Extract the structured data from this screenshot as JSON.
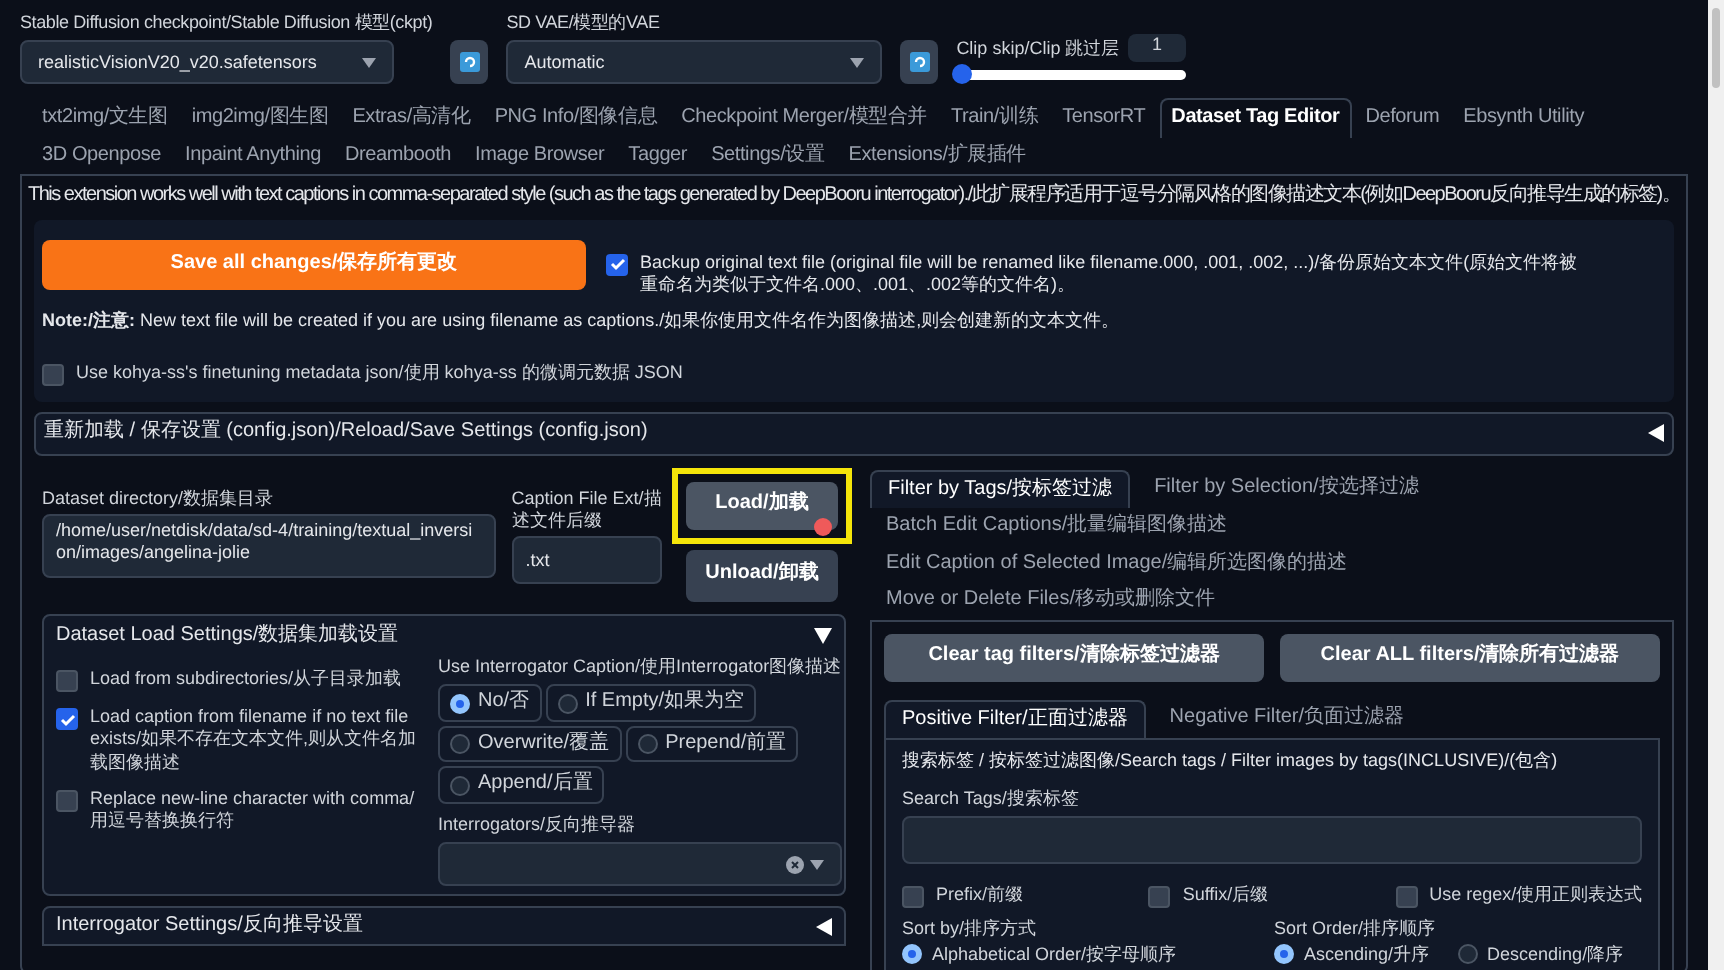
{
  "top": {
    "checkpoint": {
      "label": "Stable Diffusion checkpoint/Stable Diffusion 模型(ckpt)",
      "value": "realisticVisionV20_v20.safetensors"
    },
    "vae": {
      "label": "SD VAE/模型的VAE",
      "value": "Automatic"
    },
    "clip_skip": {
      "label": "Clip skip/Clip 跳过层",
      "value": "1",
      "level": 0.0
    }
  },
  "tabs": [
    [
      {
        "label": "txt2img/文生图",
        "selected": false
      },
      {
        "label": "img2img/图生图",
        "selected": false
      },
      {
        "label": "Extras/高清化",
        "selected": false
      },
      {
        "label": "PNG Info/图像信息",
        "selected": false
      },
      {
        "label": "Checkpoint Merger/模型合并",
        "selected": false
      },
      {
        "label": "Train/训练",
        "selected": false
      },
      {
        "label": "TensorRT",
        "selected": false
      },
      {
        "label": "Dataset Tag Editor",
        "selected": true
      },
      {
        "label": "Deforum",
        "selected": false
      },
      {
        "label": "Ebsynth Utility",
        "selected": false
      }
    ],
    [
      {
        "label": "3D Openpose",
        "selected": false
      },
      {
        "label": "Inpaint Anything",
        "selected": false
      },
      {
        "label": "Dreambooth",
        "selected": false
      },
      {
        "label": "Image Browser",
        "selected": false
      },
      {
        "label": "Tagger",
        "selected": false
      },
      {
        "label": "Settings/设置",
        "selected": false
      },
      {
        "label": "Extensions/扩展插件",
        "selected": false
      }
    ]
  ],
  "info": "This extension works well with text captions in comma-separated style (such as the tags generated by DeepBooru interrogator)./此扩展程序适用于逗号分隔风格的图像描述文本(例如DeepBooru反向推导生成的标签)。",
  "save_button": "Save all changes/保存所有更改",
  "backup": {
    "label": "Backup original text file (original file will be renamed like filename.000, .001, .002, ...)/备份原始文本文件(原始文件将被重命名为类似于文件名.000、.001、.002等的文件名)。",
    "checked": true
  },
  "note": "**Note:/注意:** New text file will be created if you are using filename as captions./如果你使用文件名作为图像描述,则会创建新的文本文件。",
  "kohya": {
    "label": "Use kohya-ss's finetuning metadata json/使用 kohya-ss 的微调元数据 JSON",
    "checked": false
  },
  "reload_section": {
    "title": "重新加载 / 保存设置 (config.json)/Reload/Save Settings (config.json)",
    "expanded": false
  },
  "dataset_dir": {
    "label": "Dataset directory/数据集目录",
    "value": "/home/user/netdisk/data/sd-4/training/textual_inversion/images/angelina-jolie"
  },
  "caption_ext": {
    "label": "Caption File Ext/描述文件后缀",
    "value": ".txt"
  },
  "load_button": {
    "label": "Load/加载",
    "highlighted": true
  },
  "unload_button": "Unload/卸载",
  "load_settings": {
    "title": "Dataset Load Settings/数据集加载设置",
    "expanded": true,
    "options": [
      {
        "label": "Load from subdirectories/从子目录加载",
        "checked": false
      },
      {
        "label": "Load caption from filename if no text file exists/如果不存在文本文件,则从文件名加载图像描述",
        "checked": true
      },
      {
        "label": "Replace new-line character with comma/用逗号替换换行符",
        "checked": false
      }
    ],
    "interrogator_caption": {
      "label": "Use Interrogator Caption/使用Interrogator图像描述",
      "options": [
        {
          "label": "No/否",
          "selected": true
        },
        {
          "label": "If Empty/如果为空",
          "selected": false
        },
        {
          "label": "Overwrite/覆盖",
          "selected": false
        },
        {
          "label": "Prepend/前置",
          "selected": false
        },
        {
          "label": "Append/后置",
          "selected": false
        }
      ]
    },
    "interrogators_label": "Interrogators/反向推导器"
  },
  "interrogator_settings": {
    "title": "Interrogator Settings/反向推导设置",
    "expanded": false
  },
  "right_tabs": [
    {
      "label": "Filter by Tags/按标签过滤",
      "selected": true
    },
    {
      "label": "Filter by Selection/按选择过滤",
      "selected": false
    },
    {
      "label": "Batch Edit Captions/批量编辑图像描述",
      "selected": false
    },
    {
      "label": "Edit Caption of Selected Image/编辑所选图像的描述",
      "selected": false
    },
    {
      "label": "Move or Delete Files/移动或删除文件",
      "selected": false
    }
  ],
  "clear_buttons": [
    "Clear tag filters/清除标签过滤器",
    "Clear ALL filters/清除所有过滤器"
  ],
  "filter_tabs": [
    {
      "label": "Positive Filter/正面过滤器",
      "selected": true
    },
    {
      "label": "Negative Filter/负面过滤器",
      "selected": false
    }
  ],
  "filter_heading": "搜索标签 / 按标签过滤图像/Search tags / Filter images by tags(INCLUSIVE)/(包含)",
  "search_tags_label": "Search Tags/搜索标签",
  "filter_options": [
    {
      "label": "Prefix/前缀",
      "checked": false
    },
    {
      "label": "Suffix/后缀",
      "checked": false
    },
    {
      "label": "Use regex/使用正则表达式",
      "checked": false
    }
  ],
  "sort_by": {
    "label": "Sort by/排序方式",
    "options": [
      {
        "label": "Alphabetical Order/按字母顺序",
        "selected": true
      }
    ]
  },
  "sort_order": {
    "label": "Sort Order/排序顺序",
    "options": [
      {
        "label": "Ascending/升序",
        "selected": true
      },
      {
        "label": "Descending/降序",
        "selected": false
      }
    ]
  }
}
